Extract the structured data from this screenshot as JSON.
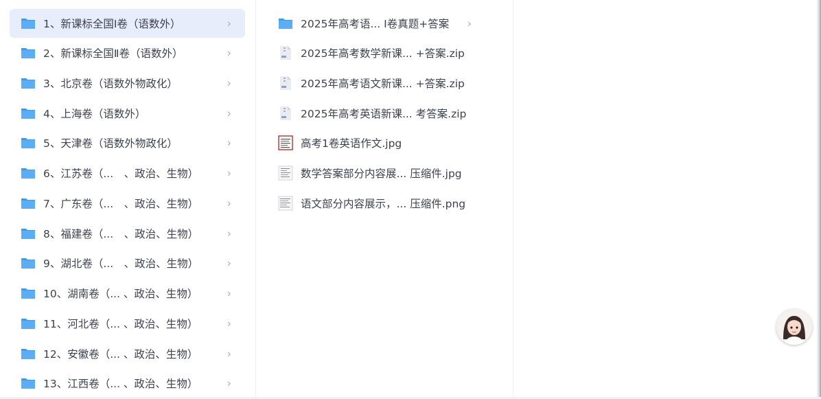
{
  "folders": [
    {
      "label": "1、新课标全国Ⅰ卷（语数外）",
      "selected": true
    },
    {
      "label": "2、新课标全国Ⅱ卷（语数外）"
    },
    {
      "label": "3、北京卷（语数外物政化）"
    },
    {
      "label": "4、上海卷（语数外）"
    },
    {
      "label": "5、天津卷（语数外物政化）"
    },
    {
      "label": "6、江苏卷（...　、政治、生物）"
    },
    {
      "label": "7、广东卷（...　、政治、生物）"
    },
    {
      "label": "8、福建卷（...　、政治、生物）"
    },
    {
      "label": "9、湖北卷（...　、政治、生物）"
    },
    {
      "label": "10、湖南卷（... 、政治、生物）"
    },
    {
      "label": "11、河北卷（... 、政治、生物）"
    },
    {
      "label": "12、安徽卷（... 、政治、生物）"
    },
    {
      "label": "13、江西卷（... 、政治、生物）"
    }
  ],
  "files": [
    {
      "label": "2025年高考语...  Ⅰ卷真题+答案",
      "kind": "folder",
      "has_chevron": true
    },
    {
      "label": "2025年高考数学新课...   +答案.zip",
      "kind": "zip"
    },
    {
      "label": "2025年高考语文新课...   +答案.zip",
      "kind": "zip"
    },
    {
      "label": "2025年高考英语新课...  考答案.zip",
      "kind": "zip"
    },
    {
      "label": "高考1卷英语作文.jpg",
      "kind": "jpg-red"
    },
    {
      "label": "数学答案部分内容展...  压缩件.jpg",
      "kind": "jpg-doc"
    },
    {
      "label": "语文部分内容展示，...  压缩件.png",
      "kind": "png-doc"
    }
  ],
  "icons": {
    "chevron": "›",
    "folder_color": "#4aa3f0",
    "folder_tab_color": "#7fc0f7"
  }
}
